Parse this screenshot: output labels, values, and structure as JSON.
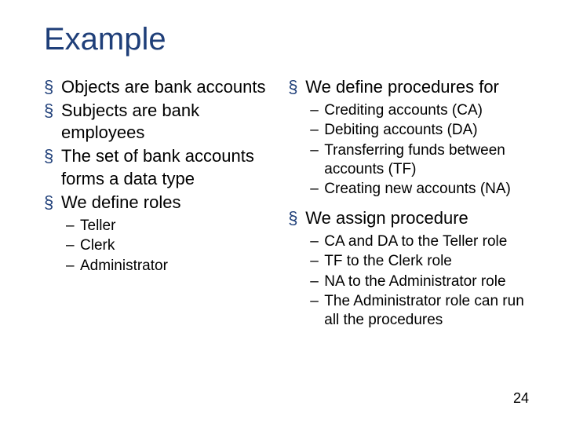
{
  "title": "Example",
  "left": {
    "items": [
      "Objects are bank accounts",
      "Subjects are bank employees",
      "The set of bank accounts forms a data type",
      "We define roles"
    ],
    "roles": [
      "Teller",
      "Clerk",
      "Administrator"
    ]
  },
  "right": {
    "procLabel": "We define procedures for",
    "procedures": [
      "Crediting accounts (CA)",
      "Debiting accounts (DA)",
      "Transferring funds between accounts (TF)",
      "Creating new accounts (NA)"
    ],
    "assignLabel": "We assign procedure",
    "assignments": [
      "CA and DA to the Teller role",
      "TF to the Clerk role",
      "NA to the Administrator role",
      "The Administrator role can run all the procedures"
    ]
  },
  "pageNumber": "24"
}
